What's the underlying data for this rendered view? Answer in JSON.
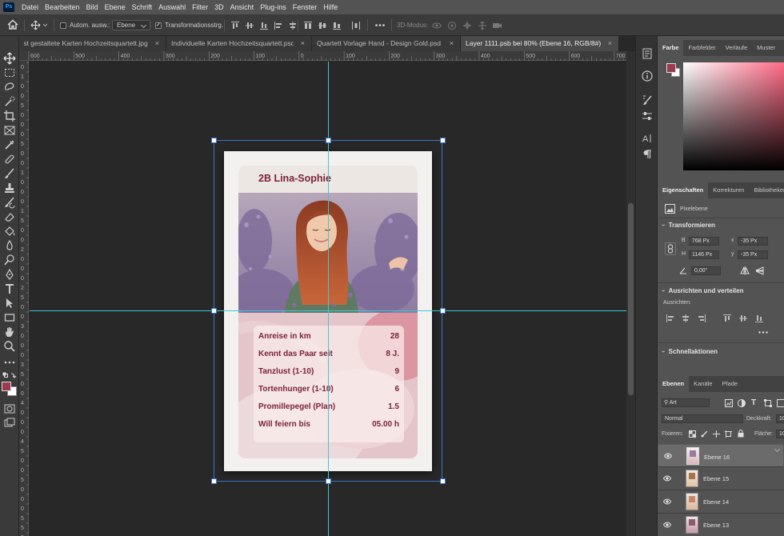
{
  "app": {
    "name": "Ps"
  },
  "menu": [
    "Datei",
    "Bearbeiten",
    "Bild",
    "Ebene",
    "Schrift",
    "Auswahl",
    "Filter",
    "3D",
    "Ansicht",
    "Plug-ins",
    "Fenster",
    "Hilfe"
  ],
  "options": {
    "auto_select_label": "Autom. ausw.:",
    "auto_select_value": "Ebene",
    "transform_label": "Transformationsstrg.",
    "mode_3d_label": "3D-Modus:"
  },
  "tabs": [
    {
      "label": "selbst gestaltete Karten Hochzeitsquartett.jpg",
      "active": false
    },
    {
      "label": "Individuelle Karten Hochzeitsquartett.psd",
      "active": false
    },
    {
      "label": "Quartett Vorlage Hand - Design Gold.psd",
      "active": false
    },
    {
      "label": "Layer 1111.psb bei 80% (Ebene 16, RGB/8#) *",
      "active": true
    }
  ],
  "ruler_h": [
    "600",
    "500",
    "400",
    "300",
    "200",
    "100",
    "0",
    "100",
    "200",
    "300",
    "400",
    "500",
    "600",
    "700",
    "800",
    "900",
    "1000",
    "1100",
    "1200",
    "1300"
  ],
  "ruler_v": [
    "0",
    "1",
    "0",
    "0",
    "5",
    "0",
    "0",
    "0",
    "5",
    "0",
    "0",
    "1",
    "0",
    "0",
    "0",
    "1",
    "5",
    "0",
    "0",
    "2",
    "0",
    "0",
    "0",
    "2",
    "5",
    "0",
    "0",
    "3",
    "0",
    "0",
    "0",
    "3",
    "5",
    "0",
    "0",
    "4",
    "0",
    "0",
    "0",
    "4",
    "5",
    "0",
    "0",
    "5",
    "0",
    "0",
    "0",
    "5",
    "5",
    "0"
  ],
  "card": {
    "name": "2B  Lina-Sophie",
    "stats": [
      {
        "label": "Anreise in km",
        "value": "28"
      },
      {
        "label": "Kennt das Paar seit",
        "value": "8 J."
      },
      {
        "label": "Tanzlust (1-10)",
        "value": "9"
      },
      {
        "label": "Tortenhunger (1-10)",
        "value": "6"
      },
      {
        "label": "Promillepegel (Plan)",
        "value": "1.5"
      },
      {
        "label": "Will feiern bis",
        "value": "05.00 h"
      }
    ]
  },
  "color_panel": {
    "tabs": [
      "Farbe",
      "Farbfelder",
      "Verläufe",
      "Muster"
    ],
    "fg": "#9b3a4e",
    "bg": "#ffffff"
  },
  "properties_panel": {
    "tabs": [
      "Eigenschaften",
      "Korrekturen",
      "Bibliotheken"
    ],
    "layer_type": "Pixelebene",
    "transform_title": "Transformieren",
    "w_label": "B",
    "w_value": "768 Px",
    "h_label": "H",
    "h_value": "1146 Px",
    "x_label": "x",
    "x_value": "-35 Px",
    "y_label": "y",
    "y_value": "-35 Px",
    "angle_value": "0,00°",
    "align_title": "Ausrichten und verteilen",
    "align_label": "Ausrichten:",
    "quick_title": "Schnellaktionen"
  },
  "layers_panel": {
    "tabs": [
      "Ebenen",
      "Kanäle",
      "Pfade"
    ],
    "filter_value": "Art",
    "blend_mode": "Normal",
    "opacity_label": "Deckkraft:",
    "opacity_value": "10",
    "lock_label": "Fixieren:",
    "fill_label": "Fläche:",
    "fill_value": "10",
    "layers": [
      "Ebene 16",
      "Ebene 15",
      "Ebene 14",
      "Ebene 13"
    ]
  },
  "colors": {
    "accent": "#7c2238",
    "guide": "#3cc8d6",
    "handle_border": "#3a73c4"
  }
}
